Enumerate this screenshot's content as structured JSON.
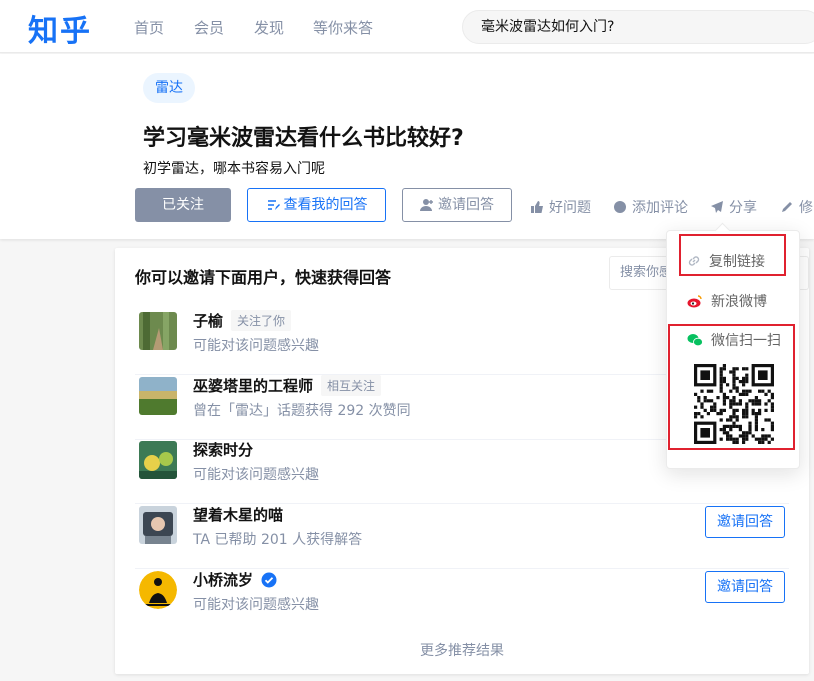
{
  "nav": {
    "logo": "知乎",
    "items": [
      "首页",
      "会员",
      "发现",
      "等你来答"
    ],
    "search_value": "毫米波雷达如何入门?"
  },
  "question": {
    "tag": "雷达",
    "title": "学习毫米波雷达看什么书比较好?",
    "description": "初学雷达，哪本书容易入门呢",
    "followed_label": "已关注",
    "my_answer_label": "查看我的回答",
    "invite_label": "邀请回答",
    "actions": {
      "good_question": "好问题",
      "add_comment": "添加评论",
      "share": "分享",
      "edit": "修"
    }
  },
  "invite_panel": {
    "title": "你可以邀请下面用户，快速获得回答",
    "search_placeholder": "搜索你感",
    "users": [
      {
        "name": "子榆",
        "badge": "关注了你",
        "desc": "可能对该问题感兴趣",
        "button": ""
      },
      {
        "name": "巫婆塔里的工程师",
        "badge": "相互关注",
        "desc": "曾在「雷达」话题获得 292 次赞同",
        "button": ""
      },
      {
        "name": "探索时分",
        "badge": "",
        "desc": "可能对该问题感兴趣",
        "button": ""
      },
      {
        "name": "望着木星的喵",
        "badge": "",
        "desc": "TA 已帮助 201 人获得解答",
        "button": "邀请回答"
      },
      {
        "name": "小桥流岁",
        "badge": "",
        "desc": "可能对该问题感兴趣",
        "button": "邀请回答",
        "verified": true
      }
    ],
    "more_results": "更多推荐结果"
  },
  "share_menu": {
    "copy_link": "复制链接",
    "weibo": "新浪微博",
    "wechat": "微信扫一扫"
  },
  "colors": {
    "brand": "#1772f6",
    "muted": "#8590a6",
    "highlight": "#e0212f",
    "wechat": "#07c160",
    "weibo": "#e6162d"
  }
}
